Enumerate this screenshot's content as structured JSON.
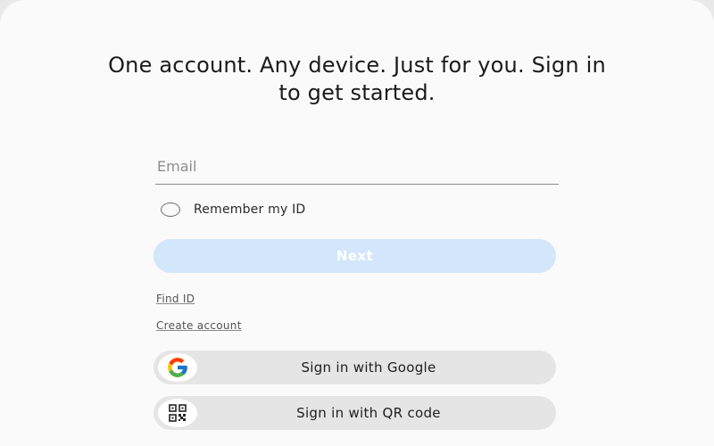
{
  "page": {
    "heading": "One account. Any device. Just for you. Sign in to get started."
  },
  "form": {
    "email_placeholder": "Email",
    "email_value": "",
    "remember_label": "Remember my ID",
    "remember_checked": false,
    "next_label": "Next"
  },
  "links": {
    "find_id": "Find ID",
    "create_account": "Create account"
  },
  "social": {
    "google_label": "Sign in with Google",
    "google_icon": "google-g-icon",
    "qr_label": "Sign in with QR code",
    "qr_icon": "qr-code-icon"
  },
  "colors": {
    "next_button_bg": "#d3e6fb",
    "social_button_bg": "#e5e5e5",
    "google_blue": "#4285F4",
    "google_red": "#EA4335",
    "google_yellow": "#FBBC05",
    "google_green": "#34A853"
  }
}
